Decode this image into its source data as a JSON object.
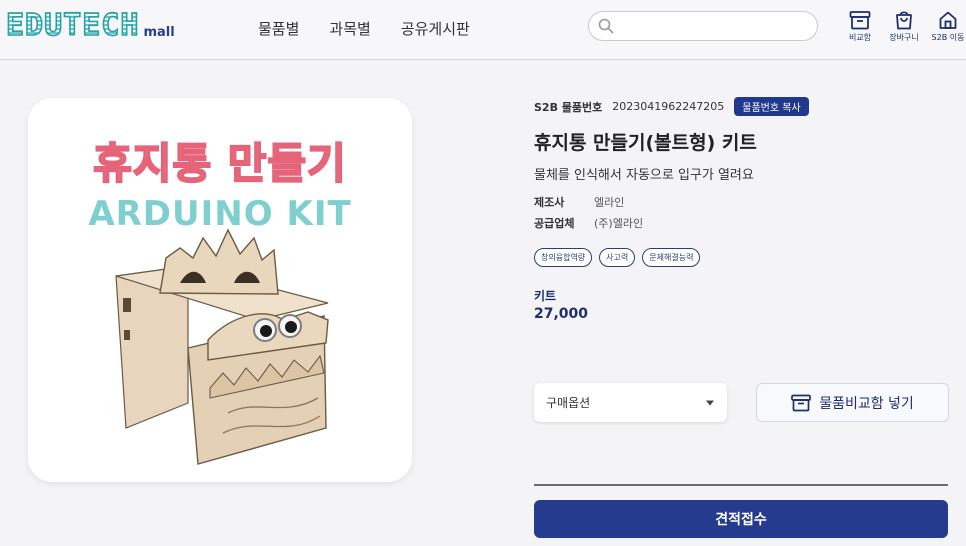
{
  "header": {
    "logo_main": "EDUTECH",
    "logo_sub": "mall",
    "nav": [
      "물품별",
      "과목별",
      "공유게시판"
    ],
    "search_placeholder": "",
    "icons": [
      {
        "icon": "archive-box-icon",
        "label": "비교함"
      },
      {
        "icon": "shopping-bag-icon",
        "label": "장바구니"
      },
      {
        "icon": "home-icon",
        "label": "S2B 이동"
      }
    ]
  },
  "product_image": {
    "title_ko": "휴지통 만들기",
    "title_en": "ARDUINO KIT"
  },
  "product": {
    "s2b_label": "S2B 물품번호",
    "s2b_number": "2023041962247205",
    "copy_label": "물품번호 복사",
    "title": "휴지통 만들기(볼트형) 키트",
    "subtitle": "물체를 인식해서 자동으로 입구가 열려요",
    "specs": [
      {
        "key": "제조사",
        "value": "엘라인"
      },
      {
        "key": "공급업체",
        "value": "(주)엘라인"
      }
    ],
    "tags": [
      "창의융합역량",
      "사고력",
      "문제해결능력"
    ],
    "price_label": "키트",
    "price": "27,000"
  },
  "actions": {
    "option_select": "구매옵션",
    "compare_button": "물품비교함 넣기",
    "quote_button": "견적접수"
  },
  "colors": {
    "brand_navy": "#243b8e",
    "logo_teal": "#27a3a8",
    "title_pink": "#f7a6b0"
  }
}
